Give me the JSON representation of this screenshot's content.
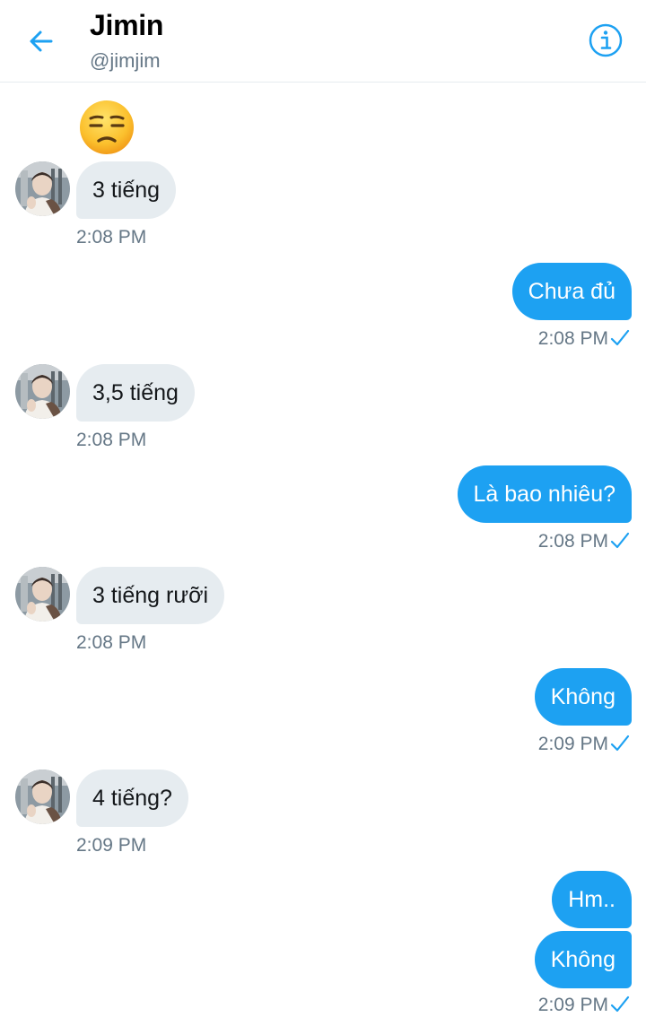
{
  "header": {
    "name": "Jimin",
    "handle": "@jimjim"
  },
  "colors": {
    "accent": "#1da1f2",
    "received_bubble": "#e6ecf0",
    "muted_text": "#657786"
  },
  "conversation": {
    "top_emoji": "unamused-face-icon",
    "messages": [
      {
        "direction": "in",
        "text": "3 tiếng",
        "time": "2:08 PM"
      },
      {
        "direction": "out",
        "text": "Chưa đủ",
        "time": "2:08 PM",
        "status": "sent-check-icon"
      },
      {
        "direction": "in",
        "text": "3,5 tiếng",
        "time": "2:08 PM"
      },
      {
        "direction": "out",
        "text": "Là bao nhiêu?",
        "time": "2:08 PM",
        "status": "sent-check-icon"
      },
      {
        "direction": "in",
        "text": "3 tiếng rưỡi",
        "time": "2:08 PM"
      },
      {
        "direction": "out",
        "text": "Không",
        "time": "2:09 PM",
        "status": "sent-check-icon"
      },
      {
        "direction": "in",
        "text": "4 tiếng?",
        "time": "2:09 PM"
      },
      {
        "direction": "out",
        "text": "Hm.."
      },
      {
        "direction": "out",
        "text": "Không",
        "time": "2:09 PM",
        "status": "sent-check-icon"
      }
    ]
  }
}
